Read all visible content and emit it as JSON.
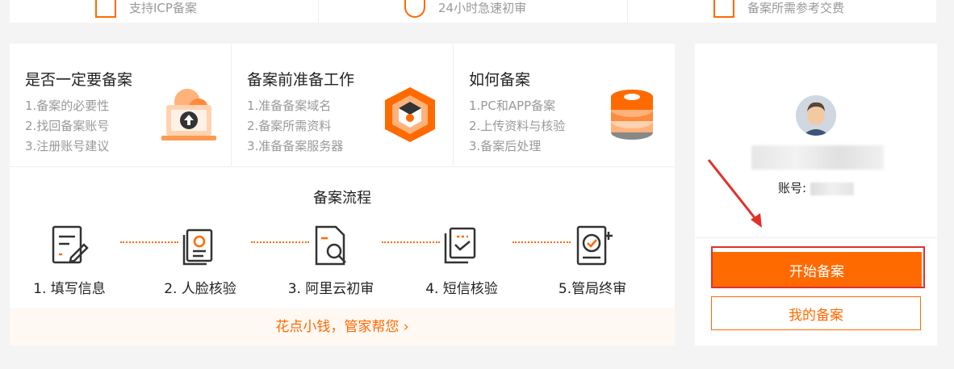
{
  "top_strip": {
    "items": [
      {
        "label": "支持ICP备案",
        "icon": "briefcase-icon"
      },
      {
        "label": "24小时急速初审",
        "icon": "clock-icon"
      },
      {
        "label": "备案所需参考交费",
        "icon": "grid-icon"
      }
    ]
  },
  "cards": [
    {
      "title": "是否一定要备案",
      "items": [
        "1.备案的必要性",
        "2.找回备案账号",
        "3.注册账号建议"
      ],
      "icon": "upload-laptop-icon"
    },
    {
      "title": "备案前准备工作",
      "items": [
        "1.准备备案域名",
        "2.备案所需资料",
        "3.准备备案服务器"
      ],
      "icon": "hexagon-box-icon"
    },
    {
      "title": "如何备案",
      "items": [
        "1.PC和APP备案",
        "2.上传资料与核验",
        "3.备案后处理"
      ],
      "icon": "database-stack-icon"
    }
  ],
  "flow": {
    "title": "备案流程",
    "steps": [
      {
        "label": "1. 填写信息",
        "icon": "edit-form-icon"
      },
      {
        "label": "2. 人脸核验",
        "icon": "face-verify-icon"
      },
      {
        "label": "3. 阿里云初审",
        "icon": "document-search-icon"
      },
      {
        "label": "4. 短信核验",
        "icon": "sms-verify-icon"
      },
      {
        "label": "5.管局终审",
        "icon": "approval-stamp-icon"
      }
    ]
  },
  "footer": {
    "link": "花点小钱，管家帮您 ›"
  },
  "account": {
    "label": "账号:",
    "start_button": "开始备案",
    "my_button": "我的备案"
  },
  "colors": {
    "accent": "#ff6a00",
    "highlight": "#e0322b"
  }
}
